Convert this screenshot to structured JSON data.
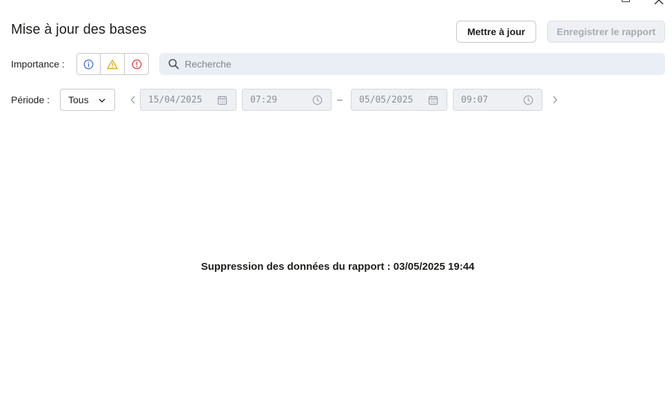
{
  "window": {
    "help_icon": "question-icon",
    "restore_icon": "restore-icon",
    "close_icon": "close-icon"
  },
  "header": {
    "title": "Mise à jour des bases",
    "update_button": "Mettre à jour",
    "save_report_button": "Enregistrer le rapport"
  },
  "filters": {
    "importance_label": "Importance :",
    "severity_buttons": [
      {
        "icon": "info-icon",
        "color": "#3d6fd0"
      },
      {
        "icon": "warning-icon",
        "color": "#e0a800"
      },
      {
        "icon": "error-icon",
        "color": "#d63a3a"
      }
    ],
    "search": {
      "placeholder": "Recherche",
      "value": ""
    },
    "period_label": "Période :",
    "period_value": "Tous",
    "date_from": "15/04/2025",
    "time_from": "07:29",
    "separator": "–",
    "date_to": "05/05/2025",
    "time_to": "09:07"
  },
  "main": {
    "message": "Suppression des données du rapport : 03/05/2025 19:44"
  }
}
